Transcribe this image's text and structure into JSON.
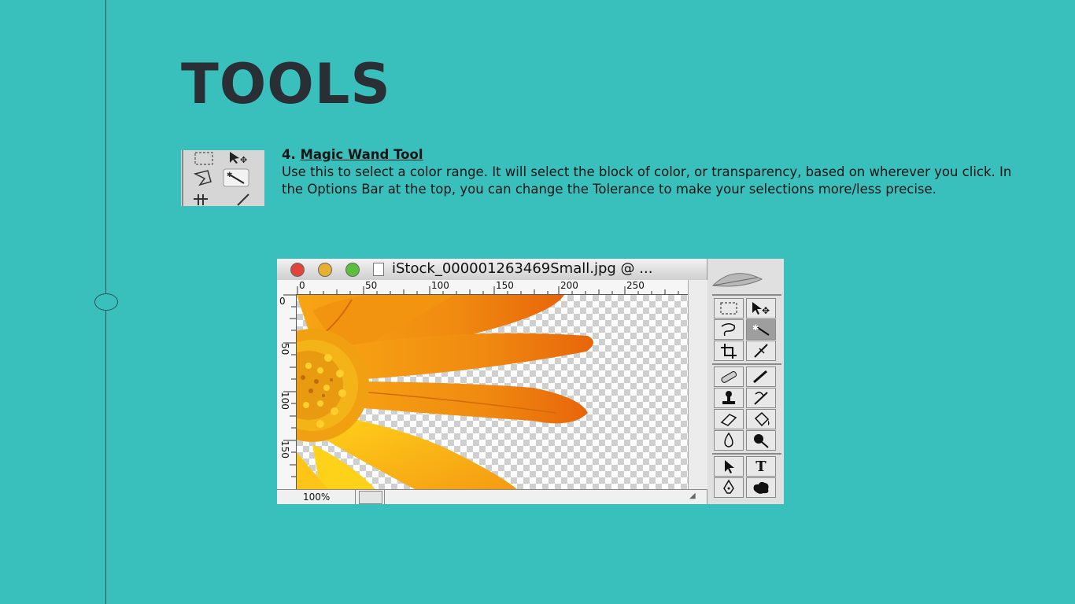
{
  "slide": {
    "title": "TOOLS",
    "item_number": "4.",
    "tool_name": "Magic Wand Tool",
    "description": "Use this to select a color range. It will select the block of color, or transparency, based on wherever you click. In the Options Bar at the top, you can change the Tolerance to make your selections more/less precise."
  },
  "screenshot": {
    "window_title": "iStock_000001263469Small.jpg @ ...",
    "ruler_h": [
      "0",
      "50",
      "100",
      "150",
      "200",
      "250"
    ],
    "ruler_v": [
      "0",
      "50",
      "100",
      "150"
    ],
    "zoom": "100%",
    "text_tool_glyph": "T"
  },
  "colors": {
    "background": "#3ac0bc",
    "title": "#2a2f36",
    "petal": "#f08a10",
    "traffic_close": "#e0443a",
    "traffic_minimize": "#e8b030",
    "traffic_zoom": "#5cbf3c"
  }
}
